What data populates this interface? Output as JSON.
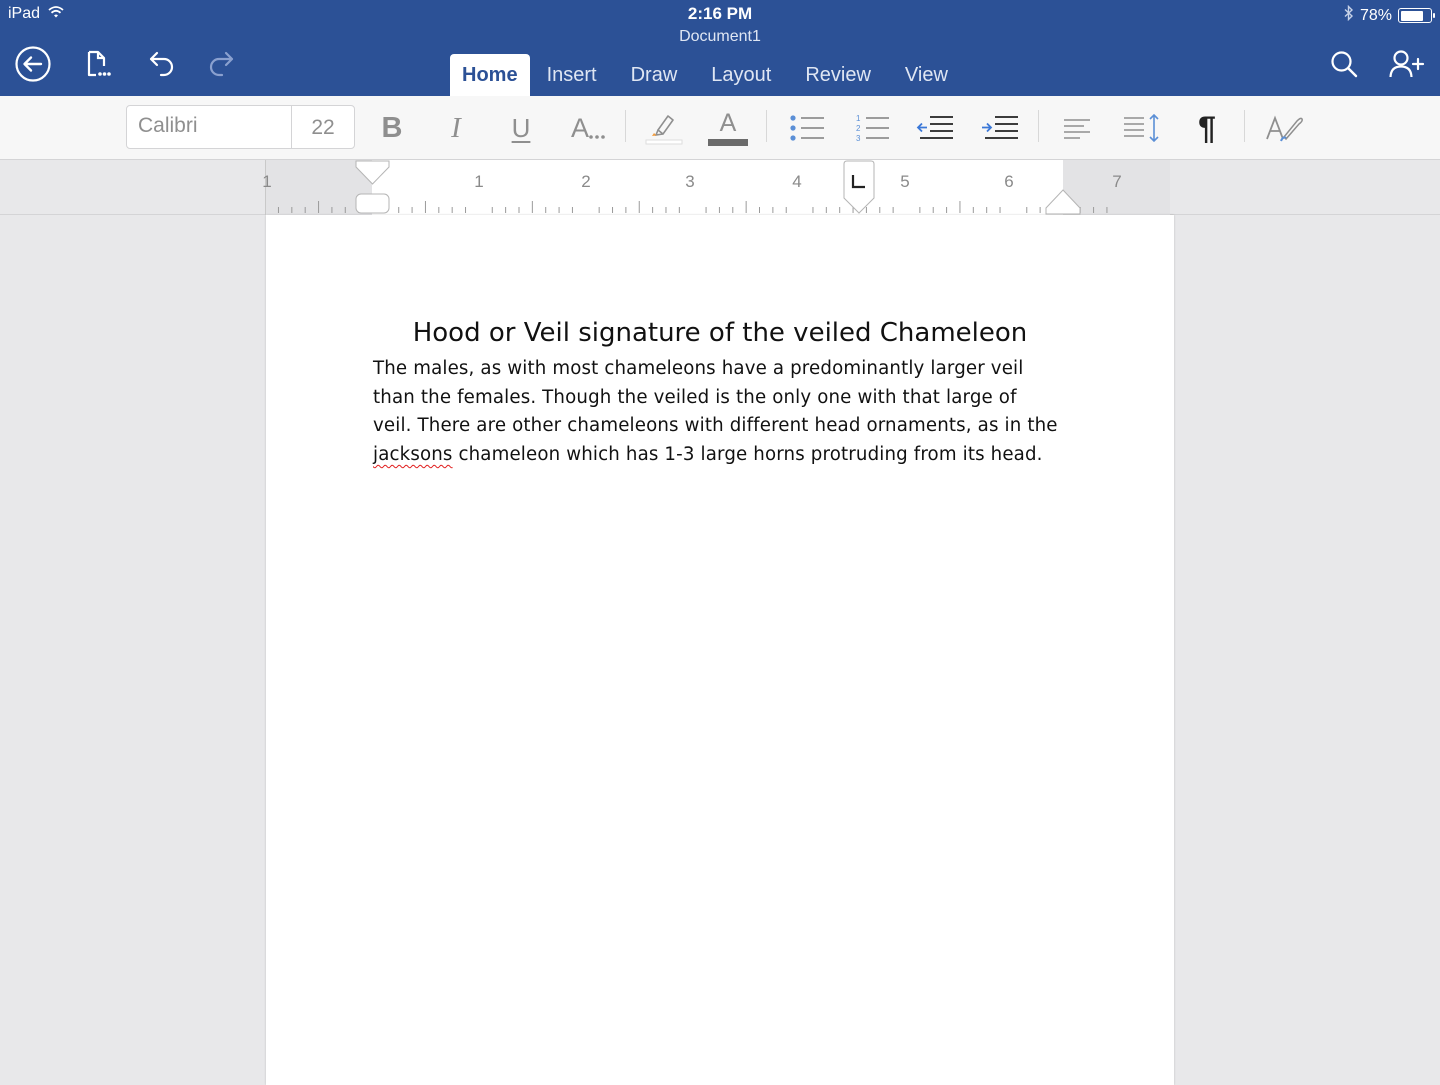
{
  "status_bar": {
    "device": "iPad",
    "time": "2:16 PM",
    "battery": "78%",
    "battery_level": 0.78
  },
  "document": {
    "title": "Document1",
    "heading": "Hood or Veil signature of the veiled Chameleon",
    "body_before": "The males, as with most chameleons have a predominantly larger veil than the females. Though the veiled is the only one with that large of veil. There are other chameleons with different head ornaments, as in the ",
    "body_misspelled": "jacksons",
    "body_after": " chameleon which has 1-3 large horns protruding from its head."
  },
  "toolbar": {
    "icons": [
      "back-icon",
      "file-icon",
      "undo-icon",
      "redo-icon",
      "search-icon",
      "share-person-icon"
    ]
  },
  "tabs": [
    {
      "label": "Home",
      "active": true
    },
    {
      "label": "Insert",
      "active": false
    },
    {
      "label": "Draw",
      "active": false
    },
    {
      "label": "Layout",
      "active": false
    },
    {
      "label": "Review",
      "active": false
    },
    {
      "label": "View",
      "active": false
    }
  ],
  "ribbon": {
    "font_name": "Calibri",
    "font_size": "22",
    "bold": "B",
    "italic": "I",
    "underline": "U",
    "font_effects": "A",
    "font_color": "A",
    "pilcrow": "¶"
  },
  "ruler": {
    "numbers": [
      "1",
      "1",
      "2",
      "3",
      "4",
      "5",
      "6",
      "7"
    ]
  },
  "colors": {
    "brand": "#2c5196",
    "spell_error": "#e01b1b"
  }
}
